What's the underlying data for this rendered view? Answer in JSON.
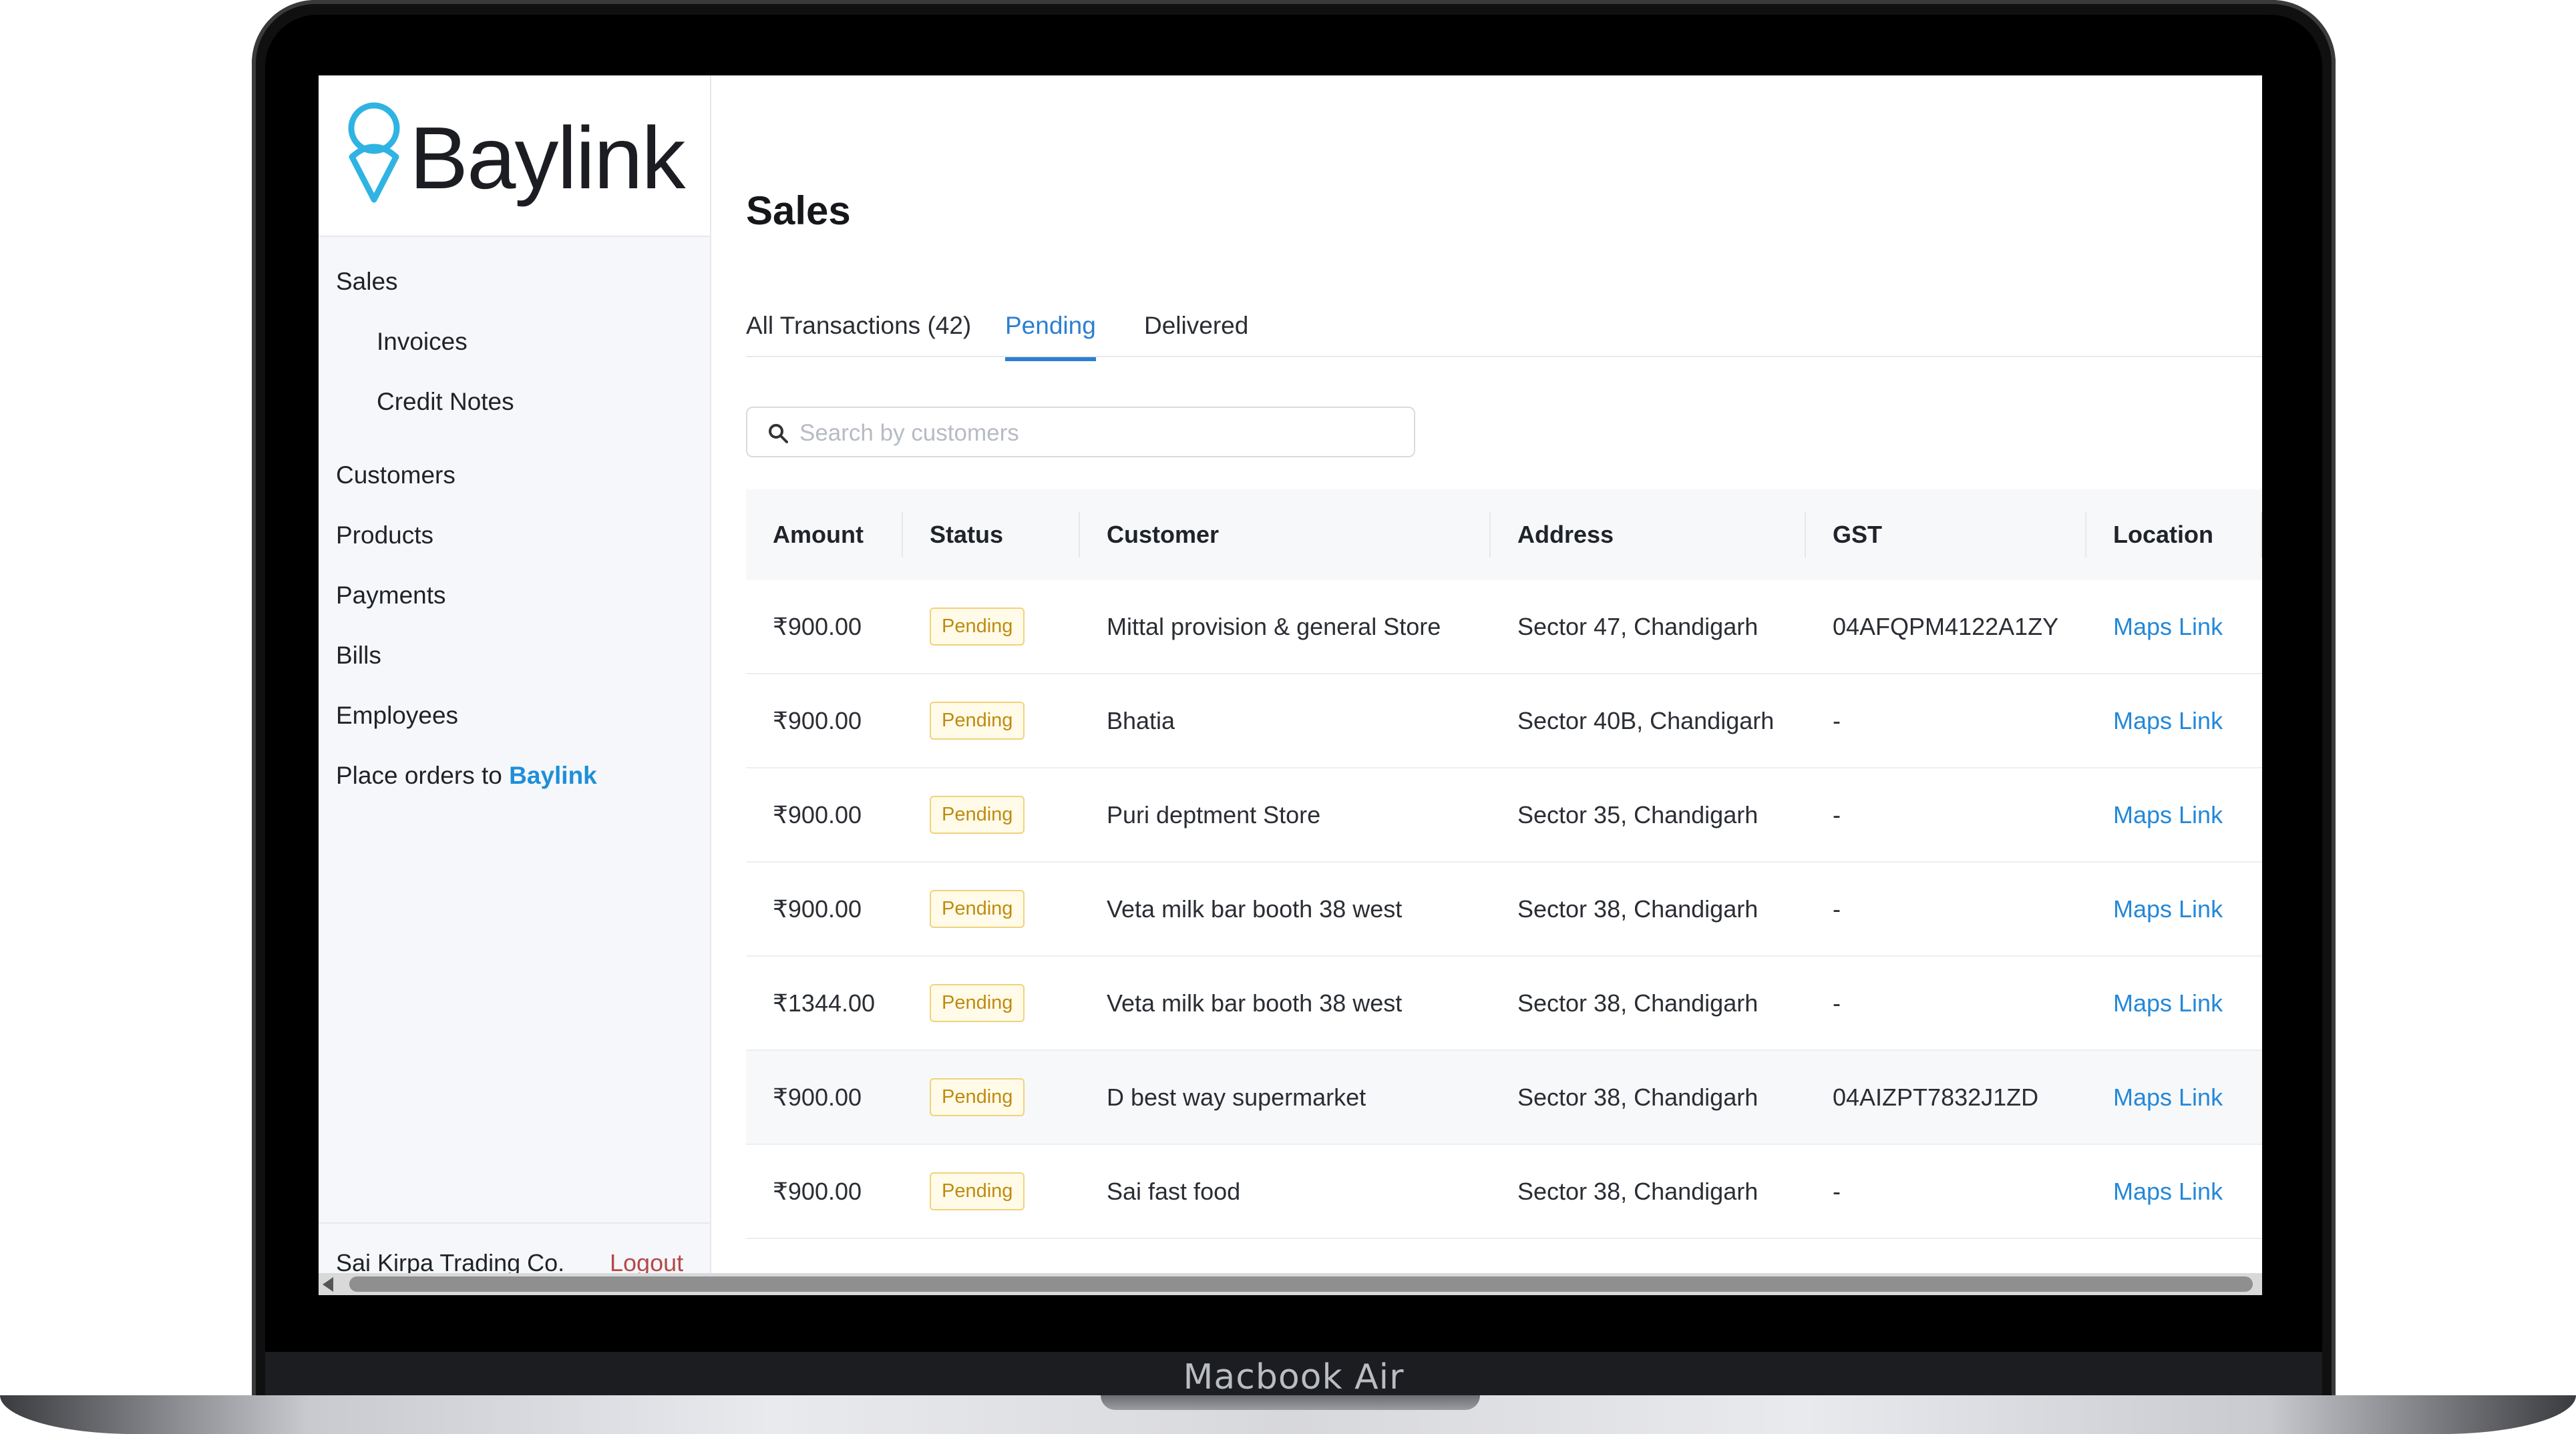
{
  "device": {
    "label": "Macbook Air"
  },
  "brand": {
    "name": "Baylink"
  },
  "sidebar": {
    "items": [
      {
        "label": "Sales"
      },
      {
        "label": "Invoices"
      },
      {
        "label": "Credit Notes"
      },
      {
        "label": "Customers"
      },
      {
        "label": "Products"
      },
      {
        "label": "Payments"
      },
      {
        "label": "Bills"
      },
      {
        "label": "Employees"
      }
    ],
    "place_orders": {
      "prefix": "Place orders to",
      "link": "Baylink"
    },
    "footer": {
      "company": "Sai Kirpa Trading Co.",
      "logout": "Logout"
    }
  },
  "page": {
    "title": "Sales"
  },
  "tabs": [
    {
      "label": "All Transactions (42)",
      "active": false
    },
    {
      "label": "Pending",
      "active": true
    },
    {
      "label": "Delivered",
      "active": false
    }
  ],
  "search": {
    "placeholder": "Search by customers",
    "value": ""
  },
  "table": {
    "columns": [
      "Amount",
      "Status",
      "Customer",
      "Address",
      "GST",
      "Location"
    ],
    "rows": [
      {
        "amount": "₹900.00",
        "status": "Pending",
        "customer": "Mittal provision & general Store",
        "address": "Sector 47, Chandigarh",
        "gst": "04AFQPM4122A1ZY",
        "location": "Maps Link"
      },
      {
        "amount": "₹900.00",
        "status": "Pending",
        "customer": "Bhatia",
        "address": "Sector 40B, Chandigarh",
        "gst": "-",
        "location": "Maps Link"
      },
      {
        "amount": "₹900.00",
        "status": "Pending",
        "customer": "Puri deptment Store",
        "address": "Sector 35, Chandigarh",
        "gst": "-",
        "location": "Maps Link"
      },
      {
        "amount": "₹900.00",
        "status": "Pending",
        "customer": "Veta milk bar booth 38 west",
        "address": "Sector 38, Chandigarh",
        "gst": "-",
        "location": "Maps Link"
      },
      {
        "amount": "₹1344.00",
        "status": "Pending",
        "customer": "Veta milk bar booth 38 west",
        "address": "Sector 38, Chandigarh",
        "gst": "-",
        "location": "Maps Link"
      },
      {
        "amount": "₹900.00",
        "status": "Pending",
        "customer": "D best way supermarket",
        "address": "Sector 38, Chandigarh",
        "gst": "04AIZPT7832J1ZD",
        "location": "Maps Link"
      },
      {
        "amount": "₹900.00",
        "status": "Pending",
        "customer": "Sai fast food",
        "address": "Sector 38, Chandigarh",
        "gst": "-",
        "location": "Maps Link"
      }
    ]
  },
  "colors": {
    "accent": "#2b7fd1",
    "link": "#2388d8",
    "pending_text": "#c08a10",
    "logout": "#b54848"
  }
}
